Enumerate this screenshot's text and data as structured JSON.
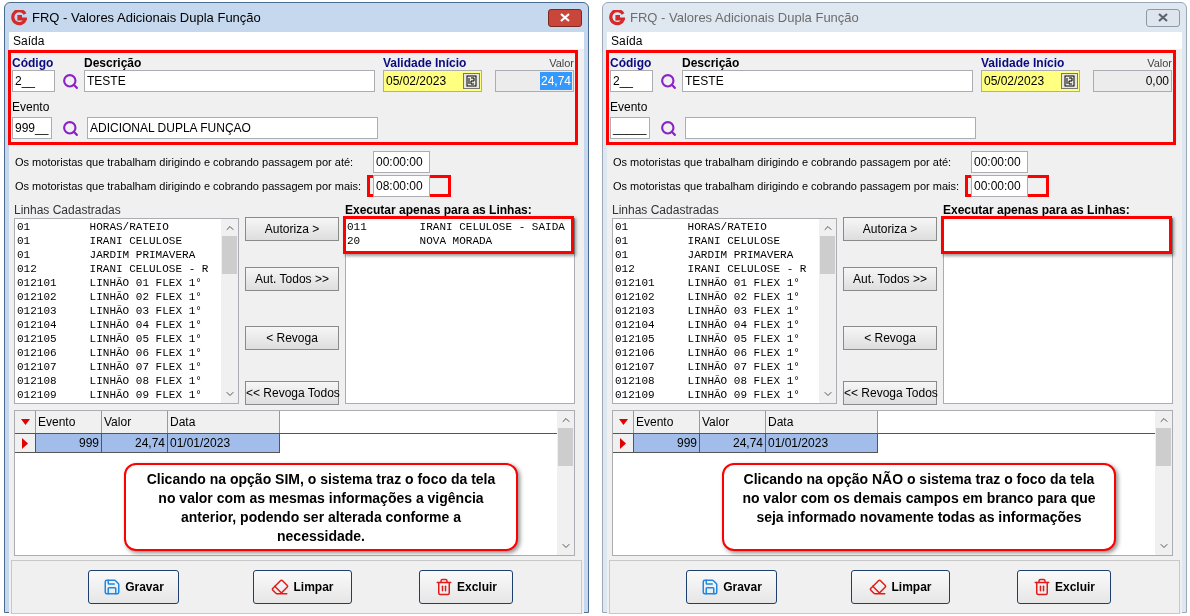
{
  "windows": [
    {
      "active": true,
      "title": "FRQ - Valores Adicionais Dupla Função",
      "menu": [
        "Saída"
      ],
      "header": {
        "highlighted": true,
        "codigo_label": "Código",
        "codigo": "2__",
        "descricao_label": "Descrição",
        "descricao": "TESTE",
        "validade_label": "Validade Início",
        "validade": "05/02/2023",
        "valor_label": "Valor",
        "valor": "24,74",
        "valor_selected": true,
        "evento_label": "Evento",
        "evento": "999__",
        "evento_descricao": "ADICIONAL DUPLA FUNÇAO"
      },
      "time_rows": [
        {
          "label": "Os motoristas que trabalham dirigindo e cobrando passagem por até:",
          "value": "00:00:00",
          "highlighted": false
        },
        {
          "label": "Os motoristas que trabalham dirigindo e cobrando passagem por mais:",
          "value": "08:00:00",
          "highlighted": true
        }
      ],
      "lines_label": "Linhas Cadastradas",
      "lines": [
        "01         HORAS/RATEIO",
        "01         IRANI CELULOSE",
        "01         JARDIM PRIMAVERA",
        "012        IRANI CELULOSE - R",
        "012101     LINHÃO 01 FLEX 1°",
        "012102     LINHÃO 02 FLEX 1°",
        "012103     LINHÃO 03 FLEX 1°",
        "012104     LINHÃO 04 FLEX 1°",
        "012105     LINHÃO 05 FLEX 1°",
        "012106     LINHÃO 06 FLEX 1°",
        "012107     LINHÃO 07 FLEX 1°",
        "012108     LINHÃO 08 FLEX 1°",
        "012109     LINHÃO 09 FLEX 1°"
      ],
      "action_buttons": [
        "Autoriza >",
        "Aut. Todos >>",
        "< Revoga",
        "<< Revoga Todos"
      ],
      "selected_label": "Executar apenas para as Linhas:",
      "selected_highlighted": true,
      "selected_lines": [
        "011        IRANI CELULOSE - SAIDA",
        "20         NOVA MORADA"
      ],
      "grid": {
        "columns": [
          "Evento",
          "Valor",
          "Data"
        ],
        "rows": [
          {
            "cells": [
              "999",
              "24,74",
              "01/01/2023"
            ],
            "selected": true
          }
        ]
      },
      "callout": "Clicando na opção SIM, o sistema traz o foco da tela no valor com as mesmas informações a vigência anterior, podendo ser alterada conforme a necessidade.",
      "buttons": [
        {
          "label": "Gravar",
          "kind": "save"
        },
        {
          "label": "Limpar",
          "kind": "clear"
        },
        {
          "label": "Excluir",
          "kind": "delete"
        }
      ]
    },
    {
      "active": false,
      "title": "FRQ - Valores Adicionais Dupla Função",
      "menu": [
        "Saída"
      ],
      "header": {
        "highlighted": true,
        "codigo_label": "Código",
        "codigo": "2__",
        "descricao_label": "Descrição",
        "descricao": "TESTE",
        "validade_label": "Validade Início",
        "validade": "05/02/2023",
        "valor_label": "Valor",
        "valor": "0,00",
        "valor_selected": false,
        "evento_label": "Evento",
        "evento": "_____"
      },
      "time_rows": [
        {
          "label": "Os motoristas que trabalham dirigindo e cobrando passagem por até:",
          "value": "00:00:00",
          "highlighted": false
        },
        {
          "label": "Os motoristas que trabalham dirigindo e cobrando passagem por mais:",
          "value": "00:00:00",
          "highlighted": true
        }
      ],
      "lines_label": "Linhas Cadastradas",
      "lines": [
        "01         HORAS/RATEIO",
        "01         IRANI CELULOSE",
        "01         JARDIM PRIMAVERA",
        "012        IRANI CELULOSE - R",
        "012101     LINHÃO 01 FLEX 1°",
        "012102     LINHÃO 02 FLEX 1°",
        "012103     LINHÃO 03 FLEX 1°",
        "012104     LINHÃO 04 FLEX 1°",
        "012105     LINHÃO 05 FLEX 1°",
        "012106     LINHÃO 06 FLEX 1°",
        "012107     LINHÃO 07 FLEX 1°",
        "012108     LINHÃO 08 FLEX 1°",
        "012109     LINHÃO 09 FLEX 1°"
      ],
      "action_buttons": [
        "Autoriza >",
        "Aut. Todos >>",
        "< Revoga",
        "<< Revoga Todos"
      ],
      "selected_label": "Executar apenas para as Linhas:",
      "selected_highlighted": true,
      "grid": {
        "columns": [
          "Evento",
          "Valor",
          "Data"
        ],
        "rows": [
          {
            "cells": [
              "999",
              "24,74",
              "01/01/2023"
            ],
            "selected": true
          }
        ]
      },
      "callout": "Clicando na opção NÃO o sistema traz o foco da tela no valor com os demais campos em branco para que seja informado novamente todas as informações",
      "buttons": [
        {
          "label": "Gravar",
          "kind": "save"
        },
        {
          "label": "Limpar",
          "kind": "clear"
        },
        {
          "label": "Excluir",
          "kind": "delete"
        }
      ]
    }
  ]
}
